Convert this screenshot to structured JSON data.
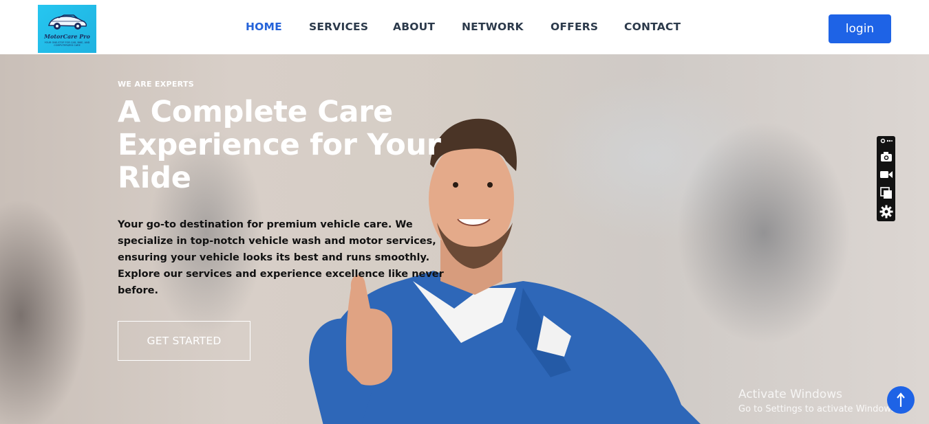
{
  "brand": {
    "name": "MotorCare Pro",
    "tagline": "YOUR ONE-STOP FOR CAR, BIKE, AND COMPUTERIZED CARE"
  },
  "nav": {
    "items": [
      {
        "label": "HOME",
        "active": true
      },
      {
        "label": "SERVICES",
        "active": false
      },
      {
        "label": "ABOUT",
        "active": false
      },
      {
        "label": "NETWORK",
        "active": false
      },
      {
        "label": "OFFERS",
        "active": false
      },
      {
        "label": "CONTACT",
        "active": false
      }
    ],
    "login_label": "login"
  },
  "hero": {
    "eyebrow": "WE ARE EXPERTS",
    "headline": "A Complete Care Experience for Your Ride",
    "description": "Your go-to destination for premium vehicle care. We specialize in top-notch vehicle wash and motor services, ensuring your vehicle looks its best and runs smoothly. Explore our services and experience excellence like never before.",
    "cta_label": "GET STARTED"
  },
  "toolbar": {
    "icons": [
      "link-icon",
      "camera-icon",
      "video-icon",
      "copy-icon",
      "gear-icon"
    ]
  },
  "watermark": {
    "title": "Activate Windows",
    "subtitle": "Go to Settings to activate Windows."
  },
  "colors": {
    "accent": "#1e63e6",
    "nav_active": "#2563d9",
    "nav_text": "#2c3a4b",
    "logo_bg": "#26c6f0"
  }
}
